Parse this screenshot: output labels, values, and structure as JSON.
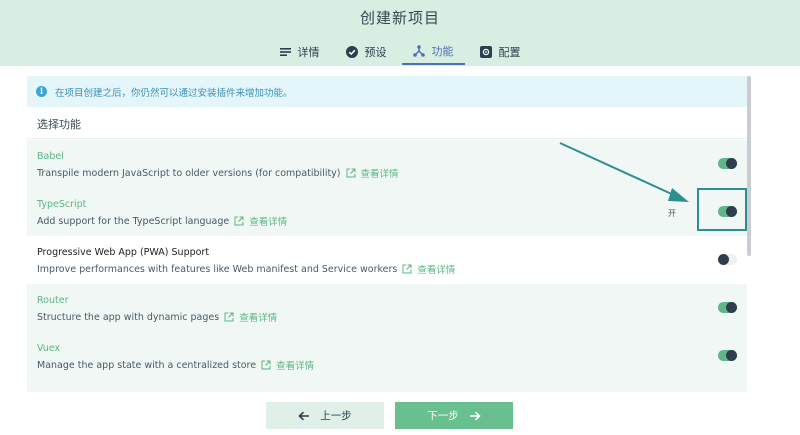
{
  "header": {
    "title": "创建新项目",
    "tabs": [
      {
        "label": "详情",
        "icon": "list-icon"
      },
      {
        "label": "预设",
        "icon": "check-circle-icon"
      },
      {
        "label": "功能",
        "icon": "branch-icon",
        "active": true
      },
      {
        "label": "配置",
        "icon": "gear-box-icon"
      }
    ]
  },
  "tip": {
    "text": "在项目创建之后，你仍然可以通过安装插件来增加功能。"
  },
  "section_title": "选择功能",
  "detail_link_label": "查看详情",
  "features": [
    {
      "name": "Babel",
      "description": "Transpile modern JavaScript to older versions (for compatibility)",
      "enabled": true
    },
    {
      "name": "TypeScript",
      "description": "Add support for the TypeScript language",
      "enabled": true,
      "state_label": "开"
    },
    {
      "name": "Progressive Web App (PWA) Support",
      "description": "Improve performances with features like Web manifest and Service workers",
      "enabled": false
    },
    {
      "name": "Router",
      "description": "Structure the app with dynamic pages",
      "enabled": true
    },
    {
      "name": "Vuex",
      "description": "Manage the app state with a centralized store",
      "enabled": true
    }
  ],
  "footer": {
    "prev_label": "上一步",
    "next_label": "下一步"
  },
  "colors": {
    "header_bg": "#d8eee2",
    "accent_green": "#5bb585",
    "active_tab": "#4f6fb8",
    "annotation_teal": "#2e8f91"
  }
}
